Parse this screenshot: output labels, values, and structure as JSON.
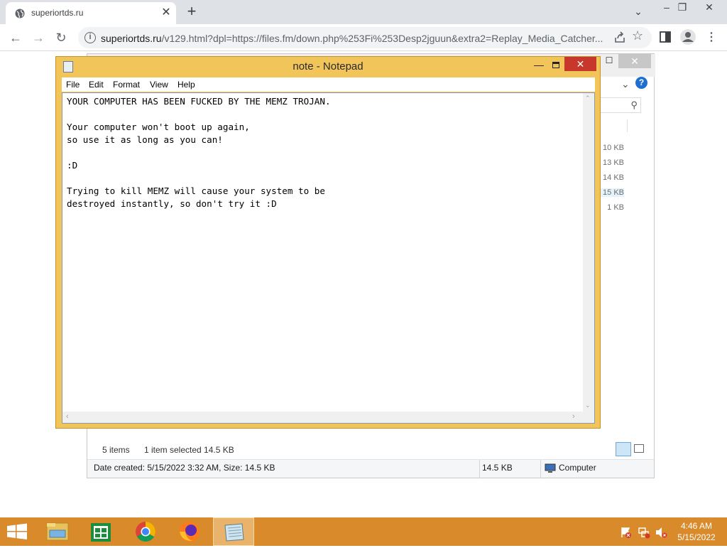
{
  "browser": {
    "tab_title": "superiortds.ru",
    "tab_close": "✕",
    "new_tab": "+",
    "url_host": "superiortds.ru",
    "url_rest": "/v129.html?dpl=https://files.fm/down.php%253Fi%253Desp2jguun&extra2=Replay_Media_Catcher...",
    "icons": [
      "globe-icon",
      "back-icon",
      "forward-icon",
      "reload-icon",
      "info-icon",
      "share-icon",
      "star-icon",
      "sidepanel-icon",
      "profile-icon",
      "menu-icon"
    ]
  },
  "explorer": {
    "sizes": [
      "10 KB",
      "13 KB",
      "14 KB",
      "15 KB",
      "1 KB"
    ],
    "items_count": "5 items",
    "selected_info": "1 item selected  14.5 KB",
    "details_text": "Date created: 5/15/2022 3:32 AM, Size: 14.5 KB",
    "details_size": "14.5 KB",
    "location": "Computer"
  },
  "notepad": {
    "title": "note - Notepad",
    "menu": [
      "File",
      "Edit",
      "Format",
      "View",
      "Help"
    ],
    "content": "YOUR COMPUTER HAS BEEN FUCKED BY THE MEMZ TROJAN.\n\nYour computer won't boot up again,\nso use it as long as you can!\n\n:D\n\nTrying to kill MEMZ will cause your system to be\ndestroyed instantly, so don't try it :D"
  },
  "taskbar": {
    "apps": [
      "file-explorer",
      "store",
      "chrome",
      "firefox",
      "notepad"
    ],
    "active_app": "notepad",
    "time": "4:46 AM",
    "date": "5/15/2022",
    "accent": "#d98a2b"
  }
}
